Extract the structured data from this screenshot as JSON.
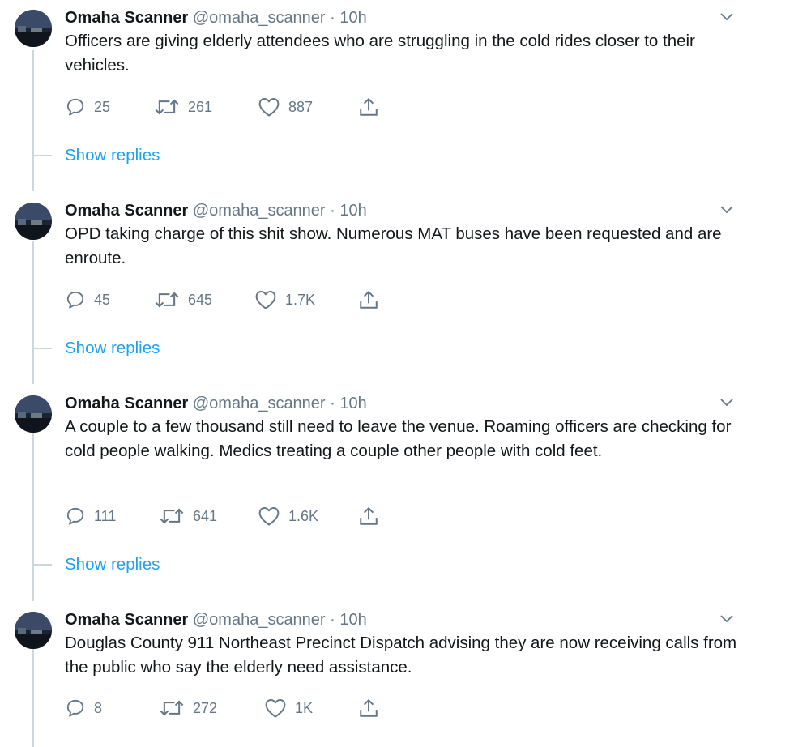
{
  "tweets": [
    {
      "name": "Omaha Scanner",
      "handle": "@omaha_scanner",
      "separator": "·",
      "time": "10h",
      "text": "Officers are giving elderly attendees who are struggling in the cold rides closer to their vehicles.",
      "replies": "25",
      "retweets": "261",
      "likes": "887"
    },
    {
      "name": "Omaha Scanner",
      "handle": "@omaha_scanner",
      "separator": "·",
      "time": "10h",
      "text": "OPD taking charge of this shit show.  Numerous MAT buses have been requested and are enroute.",
      "replies": "45",
      "retweets": "645",
      "likes": "1.7K"
    },
    {
      "name": "Omaha Scanner",
      "handle": "@omaha_scanner",
      "separator": "·",
      "time": "10h",
      "text": "A couple to a few thousand still need to leave the venue.  Roaming officers are checking for cold people walking.  Medics treating a couple other people with cold feet.",
      "replies": "111",
      "retweets": "641",
      "likes": "1.6K"
    },
    {
      "name": "Omaha Scanner",
      "handle": "@omaha_scanner",
      "separator": "·",
      "time": "10h",
      "text": "Douglas County 911 Northeast Precinct Dispatch advising they are now receiving calls from the public who say the elderly need assistance.",
      "replies": "8",
      "retweets": "272",
      "likes": "1K"
    }
  ],
  "show_replies_label": "Show replies",
  "colors": {
    "accent": "#1da1f2",
    "secondary_text": "#657786",
    "thread_line": "#ccd6dd"
  },
  "icons": {
    "reply": "reply-icon",
    "retweet": "retweet-icon",
    "like": "like-icon",
    "share": "share-icon",
    "more": "chevron-down-icon"
  }
}
